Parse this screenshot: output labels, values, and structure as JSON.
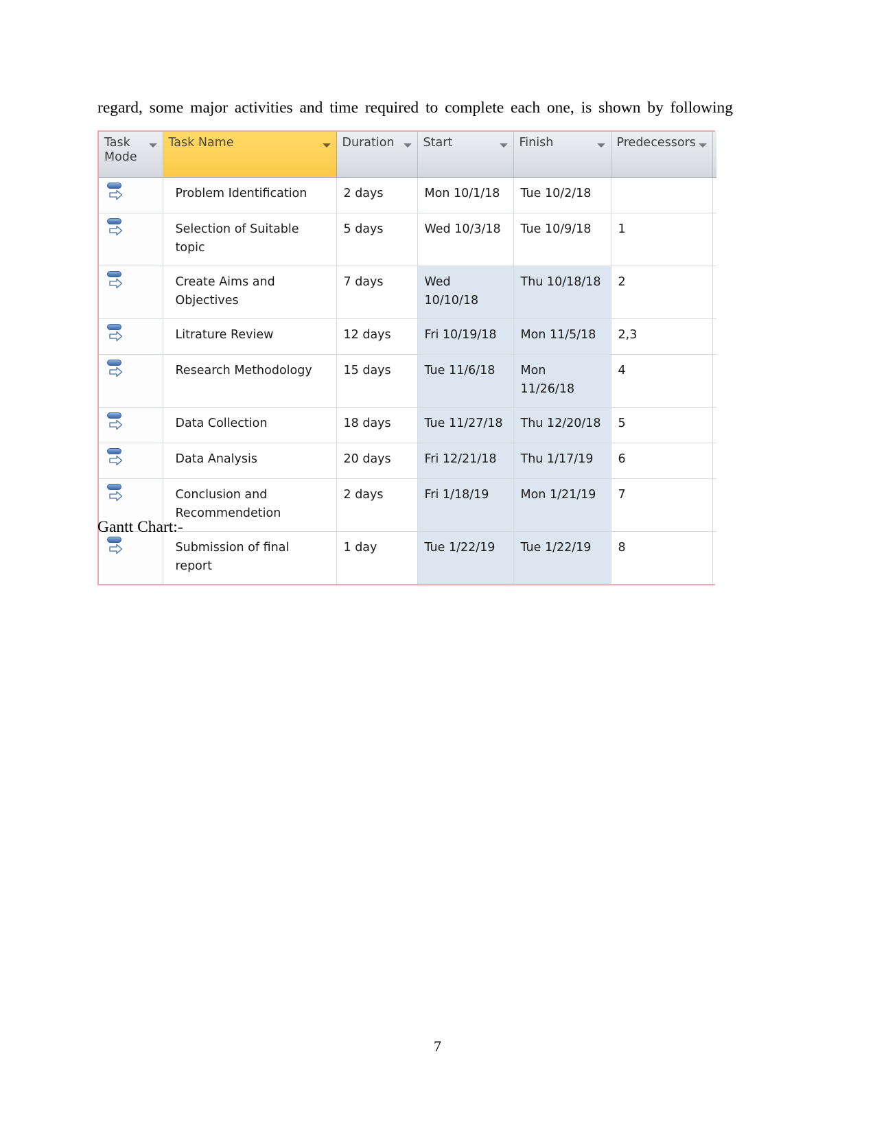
{
  "document": {
    "paragraph_text": "regard, some major activities and time required to complete each one, is shown by following",
    "gantt_caption": "Gantt Chart:-",
    "page_number": "7"
  },
  "project_table": {
    "columns": [
      {
        "key": "task_mode",
        "label": "Task Mode",
        "has_filter": true,
        "highlighted_header": false
      },
      {
        "key": "task_name",
        "label": "Task Name",
        "has_filter": true,
        "highlighted_header": true
      },
      {
        "key": "duration",
        "label": "Duration",
        "has_filter": true,
        "highlighted_header": false
      },
      {
        "key": "start",
        "label": "Start",
        "has_filter": true,
        "highlighted_header": false
      },
      {
        "key": "finish",
        "label": "Finish",
        "has_filter": true,
        "highlighted_header": false
      },
      {
        "key": "predecessors",
        "label": "Predecessors",
        "has_filter": true,
        "highlighted_header": false
      }
    ],
    "task_mode_icon": "auto-scheduled-icon",
    "rows": [
      {
        "task_mode": "Auto Scheduled",
        "task_name": "Problem Identification",
        "duration": "2 days",
        "start": "Mon 10/1/18",
        "finish": "Tue 10/2/18",
        "predecessors": ""
      },
      {
        "task_mode": "Auto Scheduled",
        "task_name": "Selection of Suitable topic",
        "duration": "5 days",
        "start": "Wed 10/3/18",
        "finish": "Tue 10/9/18",
        "predecessors": "1"
      },
      {
        "task_mode": "Auto Scheduled",
        "task_name": "Create Aims and Objectives",
        "duration": "7 days",
        "start": "Wed 10/10/18",
        "finish": "Thu 10/18/18",
        "predecessors": "2"
      },
      {
        "task_mode": "Auto Scheduled",
        "task_name": "Litrature Review",
        "duration": "12 days",
        "start": "Fri 10/19/18",
        "finish": "Mon 11/5/18",
        "predecessors": "2,3"
      },
      {
        "task_mode": "Auto Scheduled",
        "task_name": "Research Methodology",
        "duration": "15 days",
        "start": "Tue 11/6/18",
        "finish": "Mon 11/26/18",
        "predecessors": "4"
      },
      {
        "task_mode": "Auto Scheduled",
        "task_name": "Data Collection",
        "duration": "18 days",
        "start": "Tue 11/27/18",
        "finish": "Thu 12/20/18",
        "predecessors": "5"
      },
      {
        "task_mode": "Auto Scheduled",
        "task_name": "Data Analysis",
        "duration": "20 days",
        "start": "Fri 12/21/18",
        "finish": "Thu 1/17/19",
        "predecessors": "6"
      },
      {
        "task_mode": "Auto Scheduled",
        "task_name": "Conclusion and Recommendetion",
        "duration": "2 days",
        "start": "Fri 1/18/19",
        "finish": "Mon 1/21/19",
        "predecessors": "7"
      },
      {
        "task_mode": "Auto Scheduled",
        "task_name": "Submission of final report",
        "duration": "1 day",
        "start": "Tue 1/22/19",
        "finish": "Tue 1/22/19",
        "predecessors": "8"
      }
    ],
    "highlight_from_row_index": 2,
    "highlight_columns": [
      "start",
      "finish"
    ],
    "colors": {
      "task_name_header": "#ffd257",
      "header_grey": "#dfe3e8",
      "selection_highlight": "#dce6f1",
      "outer_border": "#f0a9ae",
      "grid_line": "#d6dbe1",
      "task_mode_icon": "#5b85c0"
    }
  }
}
